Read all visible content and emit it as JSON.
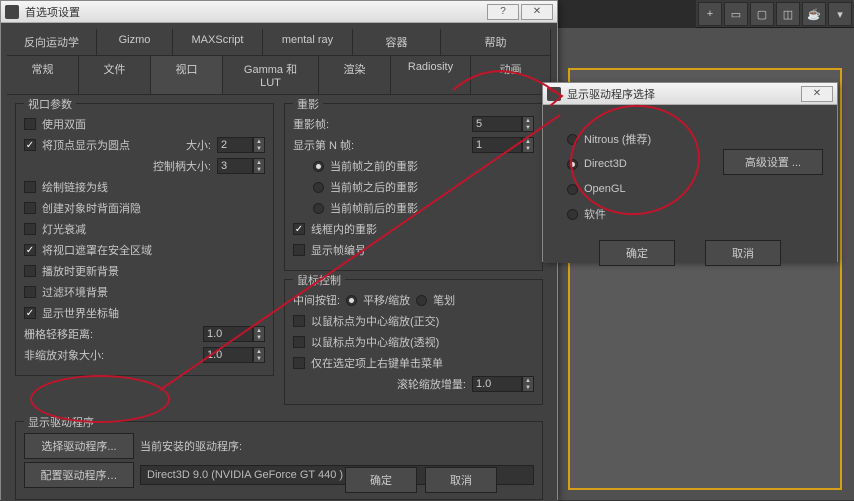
{
  "main_window": {
    "title": "首选项设置",
    "tabs_row1": [
      "反向运动学",
      "Gizmo",
      "MAXScript",
      "mental ray",
      "容器",
      "帮助"
    ],
    "tabs_row2": [
      "常规",
      "文件",
      "视口",
      "Gamma 和 LUT",
      "渲染",
      "Radiosity",
      "动画"
    ],
    "viewport_params": {
      "title": "视口参数",
      "use_double": "使用双面",
      "vertex_dots": "将顶点显示为圆点",
      "size_lbl": "大小:",
      "size_val": "2",
      "handle_lbl": "控制柄大小:",
      "handle_val": "3",
      "draw_links": "绘制链接为线",
      "backface": "创建对象时背面消隐",
      "light_atten": "灯光衰减",
      "mask_safe": "将视口遮罩在安全区域",
      "update_bg": "播放时更新背景",
      "filter_bg": "过滤环境背景",
      "world_axis": "显示世界坐标轴",
      "grid_dist_lbl": "栅格轻移距离:",
      "grid_dist_val": "1.0",
      "nonscale_lbl": "非缩放对象大小:",
      "nonscale_val": "1.0"
    },
    "ghosting": {
      "title": "重影",
      "frames_lbl": "重影帧:",
      "frames_val": "5",
      "nth_lbl": "显示第 N 帧:",
      "nth_val": "1",
      "before": "当前帧之前的重影",
      "after": "当前帧之后的重影",
      "both": "当前帧前后的重影",
      "wireframe": "线框内的重影",
      "frame_nums": "显示帧编号"
    },
    "mouse": {
      "title": "鼠标控制",
      "mmb_lbl": "中间按钮:",
      "pan": "平移/缩放",
      "stroke": "笔划",
      "center_ortho": "以鼠标点为中心缩放(正交)",
      "center_persp": "以鼠标点为中心缩放(透视)",
      "rmb_menu": "仅在选定项上右键单击菜单",
      "wheel_lbl": "滚轮缩放增量:",
      "wheel_val": "1.0"
    },
    "driver": {
      "title": "显示驱动程序",
      "choose_btn": "选择驱动程序...",
      "config_btn": "配置驱动程序…",
      "current_lbl": "当前安装的驱动程序:",
      "current_val": "Direct3D 9.0 (NVIDIA GeForce GT 440 )"
    },
    "ok": "确定",
    "cancel": "取消"
  },
  "driver_dialog": {
    "title": "显示驱动程序选择",
    "nitrous": "Nitrous (推荐)",
    "direct3d": "Direct3D",
    "opengl": "OpenGL",
    "software": "软件",
    "advanced": "高级设置 ...",
    "ok": "确定",
    "cancel": "取消"
  }
}
